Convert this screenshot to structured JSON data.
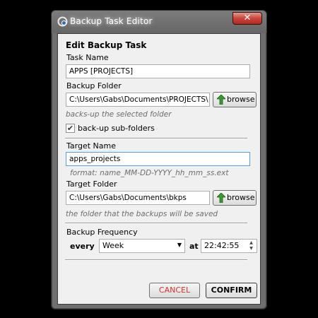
{
  "window": {
    "title": "Backup Task Editor",
    "close_symbol": "✕"
  },
  "form": {
    "heading": "Edit Backup Task",
    "task_name_label": "Task Name",
    "task_name_value": "APPS [PROJECTS]",
    "backup_folder_label": "Backup Folder",
    "backup_folder_value": "C:\\Users\\Gabs\\Documents\\PROJECTS\\",
    "browse_label": "browse",
    "backup_folder_hint": "backs-up the selected folder",
    "subfolders_checked": true,
    "subfolders_label": "back-up sub-folders",
    "target_name_label": "Target Name",
    "target_name_value": "apps_projects",
    "target_name_hint": "format: name_MM-DD-YYYY_hh_mm_ss.ext",
    "target_folder_label": "Target Folder",
    "target_folder_value": "C:\\Users\\Gabs\\Documents\\bkps",
    "target_folder_hint": "the folder that the backups will be saved",
    "frequency_label": "Backup Frequency",
    "every_label": "every",
    "frequency_value": "Week",
    "at_label": "at",
    "time_value": "22:42:55"
  },
  "buttons": {
    "cancel": "CANCEL",
    "confirm": "CONFIRM"
  },
  "icons": {
    "app": "backup-app-icon",
    "browse": "green-up-arrow-icon",
    "checkmark": "✔"
  }
}
